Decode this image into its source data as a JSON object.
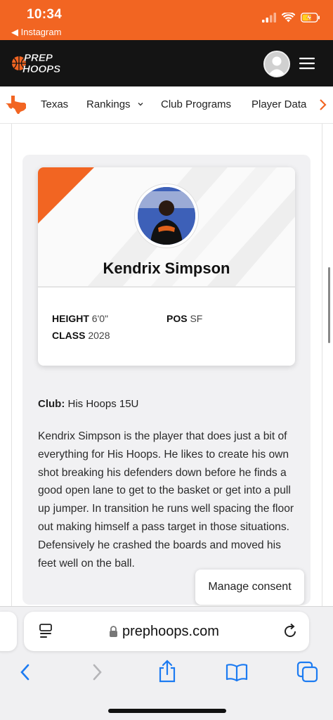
{
  "status_bar": {
    "time": "10:34",
    "back_label": "◀ Instagram",
    "accent_color": "#f26522"
  },
  "header": {
    "logo_line1": "PREP",
    "logo_line2": "HOOPS"
  },
  "nav": {
    "items": [
      {
        "label": "Texas"
      },
      {
        "label": "Rankings"
      },
      {
        "label": "Club Programs"
      },
      {
        "label": "Player Data"
      }
    ]
  },
  "player": {
    "name": "Kendrix Simpson",
    "height_label": "HEIGHT",
    "height_value": "6'0\"",
    "pos_label": "POS",
    "pos_value": "SF",
    "class_label": "CLASS",
    "class_value": "2028",
    "club_label": "Club:",
    "club_value": "His Hoops 15U",
    "bio": "Kendrix Simpson is the player that does just a bit of everything for His Hoops. He likes to create his own shot breaking his defenders down before he finds a good open lane to get to the basket or get into a pull up jumper. In transition he runs well spacing the floor out making himself a pass target in those situations. Defensively he crashed the boards and moved his feet well on the ball."
  },
  "consent": {
    "label": "Manage consent"
  },
  "browser": {
    "url": "prephoops.com"
  }
}
